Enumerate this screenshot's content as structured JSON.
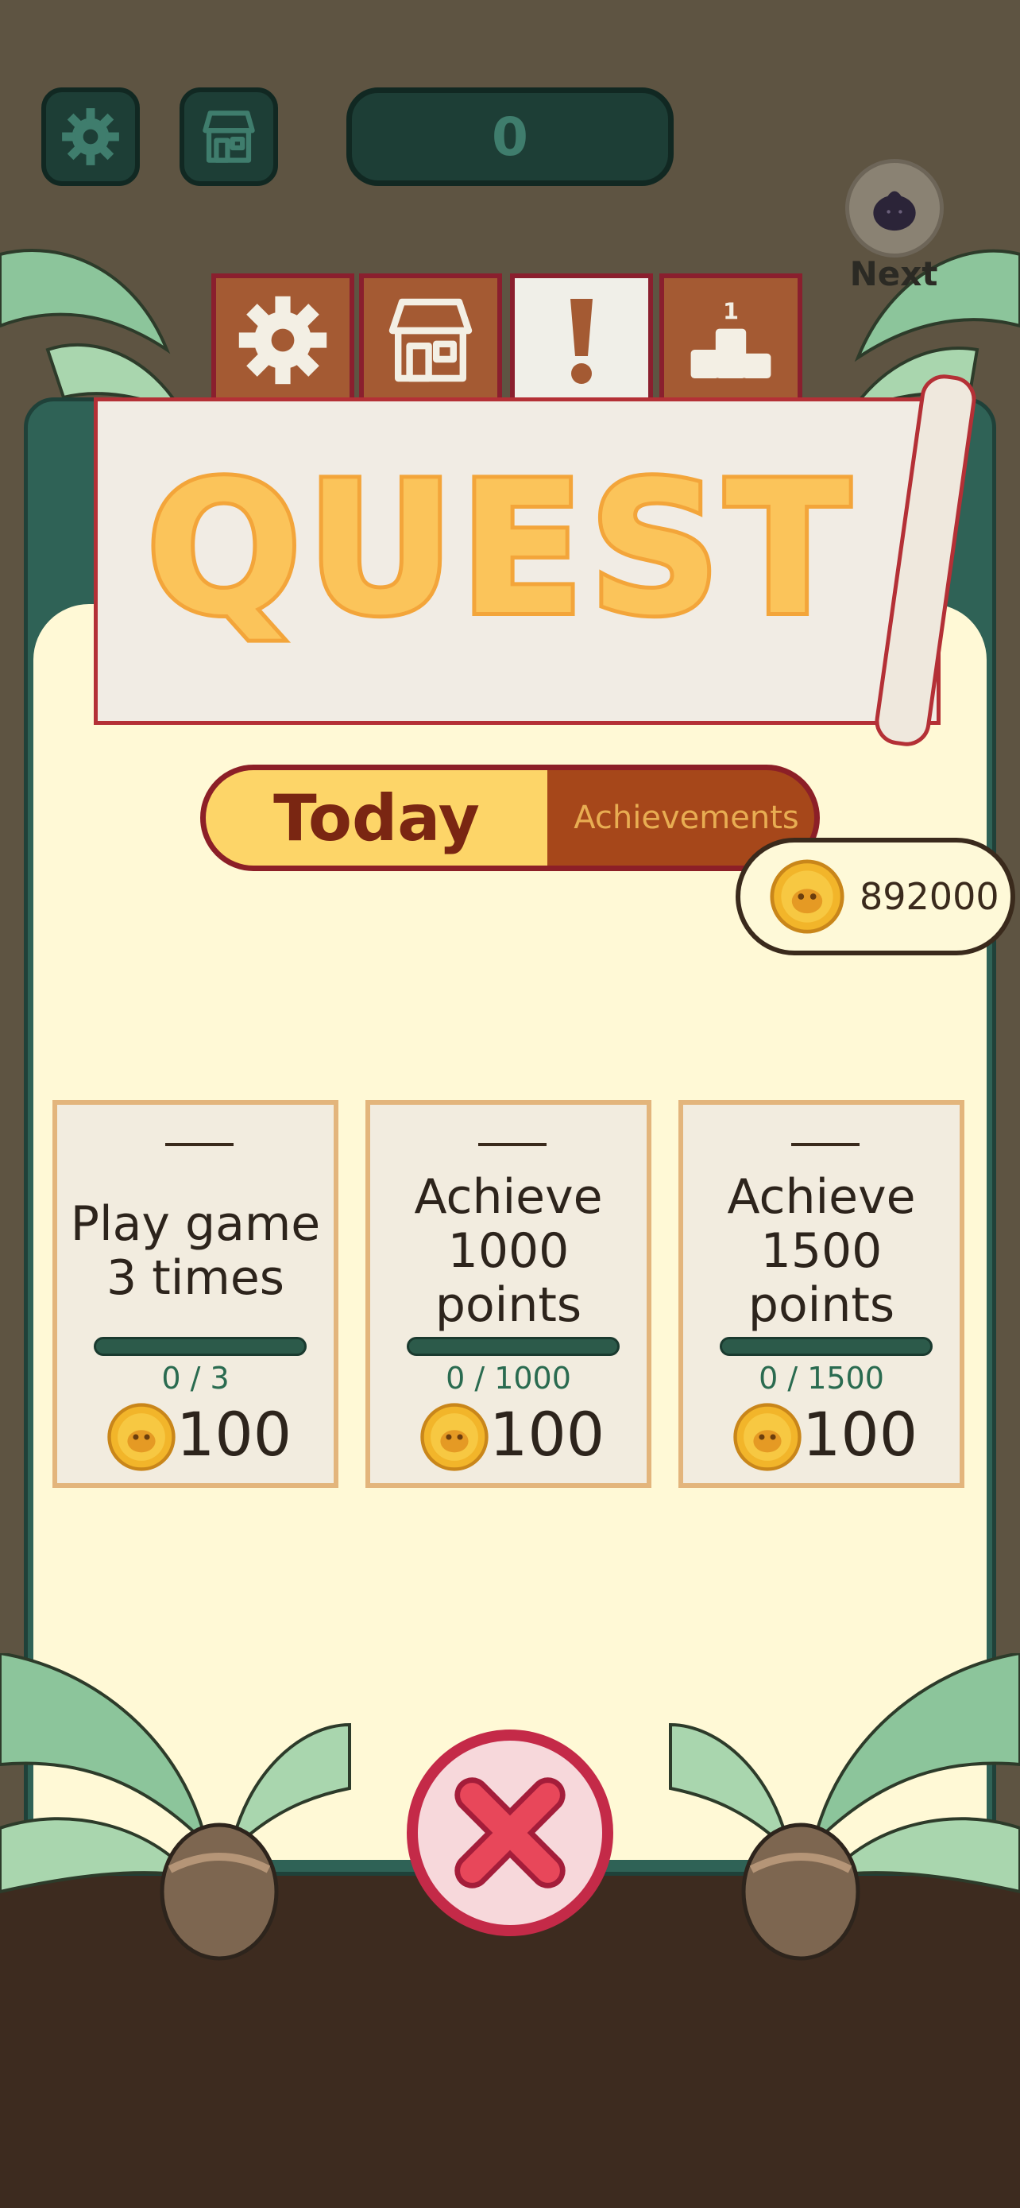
{
  "hud": {
    "score": "0",
    "next_label": "Next"
  },
  "tabs": [
    {
      "icon": "gear-icon"
    },
    {
      "icon": "shop-icon"
    },
    {
      "icon": "exclamation-icon",
      "label": "!"
    },
    {
      "icon": "podium-icon",
      "label": "1"
    }
  ],
  "banner": {
    "title": "QUEST"
  },
  "toggle": {
    "today": "Today",
    "achievements": "Achievements"
  },
  "balance": {
    "amount": "892000"
  },
  "quests": [
    {
      "title_line1": "Play game",
      "title_line2": "3 times",
      "title_line3": "",
      "progress": "0 / 3",
      "reward": "100"
    },
    {
      "title_line1": "Achieve",
      "title_line2": "1000",
      "title_line3": "points",
      "progress": "0 / 1000",
      "reward": "100"
    },
    {
      "title_line1": "Achieve",
      "title_line2": "1500",
      "title_line3": "points",
      "progress": "0 / 1500",
      "reward": "100"
    }
  ],
  "colors": {
    "panel_bg": "#fff9d6",
    "frame": "#2f6256",
    "accent_red": "#c42a48",
    "tab_brown": "#a45a33",
    "today_yellow": "#fdd568",
    "quest_letters": "#fbc45a"
  }
}
